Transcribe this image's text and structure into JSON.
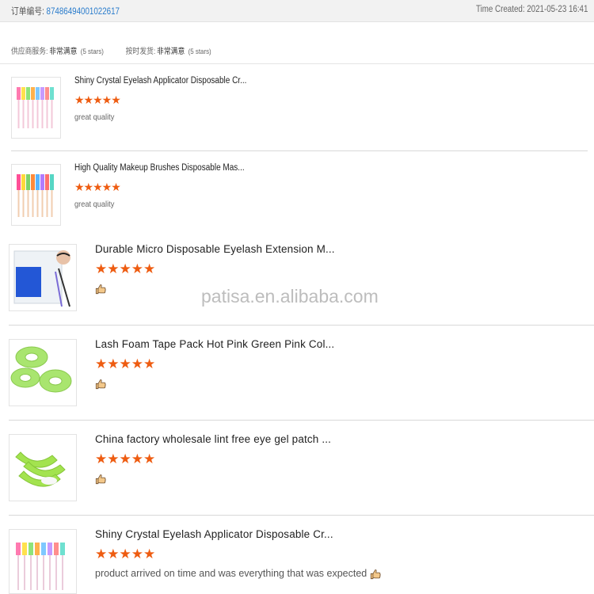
{
  "header": {
    "order_label": "订单编号:",
    "order_number": "87486494001022617",
    "time_created": "Time Created: 2021-05-23 16:41"
  },
  "ratings": {
    "supplier_label": "供应商服务:",
    "supplier_value": "非常满意",
    "supplier_count": "(5 stars)",
    "delivery_label": "按时发货:",
    "delivery_value": "非常满意",
    "delivery_count": "(5 stars)"
  },
  "reviews": [
    {
      "title": "Shiny Crystal Eyelash Applicator Disposable Cr...",
      "rating": 5,
      "stars": "★★★★★",
      "comment": "great quality",
      "thumbnail_icon": "colorful-mascara-wands-image"
    },
    {
      "title": "High Quality Makeup Brushes Disposable Mas...",
      "rating": 5,
      "stars": "★★★★★",
      "comment": "great quality",
      "thumbnail_icon": "colorful-mascara-wands-image"
    },
    {
      "title": "Durable Micro Disposable Eyelash Extension M...",
      "rating": 5,
      "stars": "★★★★★",
      "comment": "",
      "thumbnail_icon": "micro-brush-pack-image"
    },
    {
      "title": "Lash Foam Tape Pack Hot Pink Green Pink Col...",
      "rating": 5,
      "stars": "★★★★★",
      "comment": "",
      "thumbnail_icon": "green-tape-rolls-image"
    },
    {
      "title": "China factory wholesale lint free eye gel patch ...",
      "rating": 5,
      "stars": "★★★★★",
      "comment": "",
      "thumbnail_icon": "eye-gel-patches-image"
    },
    {
      "title": "Shiny Crystal Eyelash Applicator Disposable Cr...",
      "rating": 5,
      "stars": "★★★★★",
      "comment": "product arrived on time and was everything that was expected",
      "thumbnail_icon": "colorful-mascara-wands-image"
    }
  ],
  "watermark": "patisa.en.alibaba.com",
  "colors": {
    "star": "#ee5c11",
    "link": "#2a7ccc",
    "header_bg": "#f2f2f2"
  }
}
